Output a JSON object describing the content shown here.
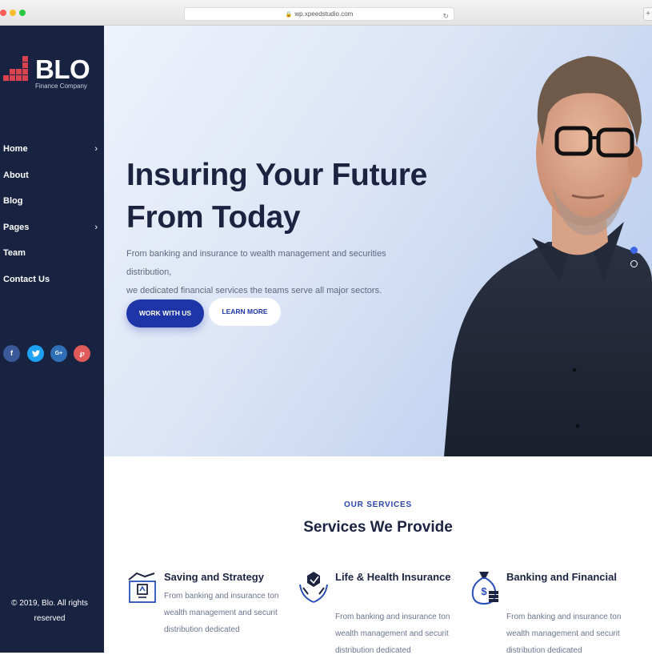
{
  "browser": {
    "url": "wp.xpeedstudio.com",
    "traffic_lights": [
      "#ff5f57",
      "#febc2e",
      "#28c840"
    ]
  },
  "brand": {
    "name": "BLO",
    "tagline": "Finance Company",
    "accent_color": "#d9434f"
  },
  "nav": {
    "items": [
      {
        "label": "Home",
        "has_submenu": true
      },
      {
        "label": "About",
        "has_submenu": false
      },
      {
        "label": "Blog",
        "has_submenu": false
      },
      {
        "label": "Pages",
        "has_submenu": true
      },
      {
        "label": "Team",
        "has_submenu": false
      },
      {
        "label": "Contact Us",
        "has_submenu": false
      }
    ]
  },
  "social": [
    {
      "icon": "facebook-icon",
      "glyph": "f",
      "color": "#3b5998"
    },
    {
      "icon": "twitter-icon",
      "glyph": "t",
      "color": "#1da1f2"
    },
    {
      "icon": "google-plus-icon",
      "glyph": "G+",
      "color": "#2f6fb8"
    },
    {
      "icon": "pinterest-icon",
      "glyph": "P",
      "color": "#e05a5a"
    }
  ],
  "footer": {
    "copyright": "© 2019, Blo. All rights reserved"
  },
  "hero": {
    "title_line1": "Insuring Your Future",
    "title_line2": "From Today",
    "text_line1": "From banking and insurance to wealth management and securities distribution,",
    "text_line2": "we dedicated financial services the teams serve all major sectors.",
    "primary_button": "WORK WITH US",
    "secondary_button": "LEARN MORE",
    "slider": {
      "total": 2,
      "active": 1
    }
  },
  "services": {
    "eyebrow": "OUR SERVICES",
    "title": "Services We Provide",
    "cards": [
      {
        "icon": "hand-building-icon",
        "title": "Saving and Strategy",
        "text": "From banking and insurance ton wealth management and securit distribution dedicated"
      },
      {
        "icon": "hands-health-icon",
        "title": "Life & Health Insurance",
        "text": "From banking and insurance ton wealth management and securit distribution dedicated"
      },
      {
        "icon": "money-bag-icon",
        "title": "Banking and Financial",
        "text": "From banking and insurance ton wealth management and securit distribution dedicated"
      }
    ]
  },
  "theme": {
    "sidebar_bg": "#182342",
    "primary": "#1e35a8",
    "heading": "#1c2340"
  }
}
